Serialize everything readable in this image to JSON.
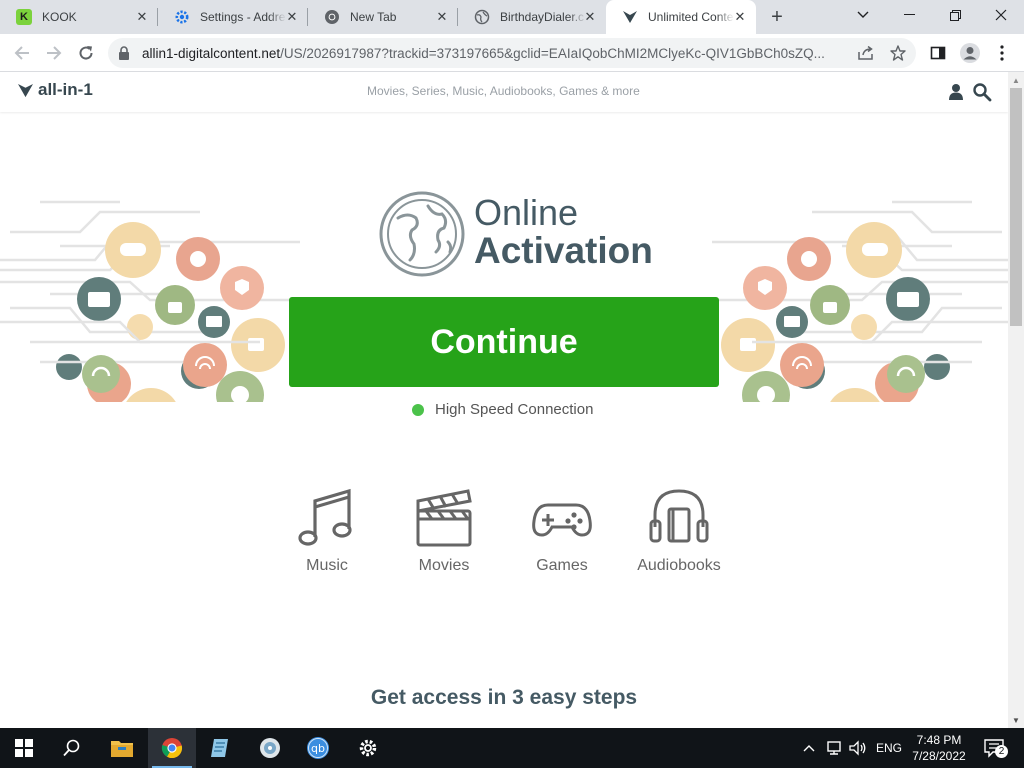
{
  "browser": {
    "tabs": [
      {
        "title": "KOOK",
        "icon": "kook-icon",
        "active": false
      },
      {
        "title": "Settings - Addre",
        "icon": "settings-gear-icon",
        "active": false
      },
      {
        "title": "New Tab",
        "icon": "chrome-icon",
        "active": false
      },
      {
        "title": "BirthdayDialer.c",
        "icon": "globe-icon",
        "active": false
      },
      {
        "title": "Unlimited Conte",
        "icon": "all-in-1-icon",
        "active": true
      }
    ],
    "url_host": "allin1-digitalcontent.net",
    "url_rest": "/US/2026917987?trackid=373197665&gclid=EAIaIQobChMI2MClyeKc-QIV1GbBCh0sZQ...",
    "accent_color": "#1a73e8"
  },
  "site": {
    "logo_text": "all-in-1",
    "tagline": "Movies, Series, Music, Audiobooks, Games & more",
    "hero_line1": "Online",
    "hero_line2": "Activation",
    "continue_label": "Continue",
    "continue_color": "#26a319",
    "connection_text": "High Speed Connection",
    "categories": [
      {
        "label": "Music",
        "icon": "music-note-icon"
      },
      {
        "label": "Movies",
        "icon": "clapperboard-icon"
      },
      {
        "label": "Games",
        "icon": "gamepad-icon"
      },
      {
        "label": "Audiobooks",
        "icon": "headphones-book-icon"
      }
    ],
    "steps_title": "Get access in 3 easy steps"
  },
  "taskbar": {
    "pinned": [
      "start-icon",
      "search-icon",
      "file-explorer-icon",
      "chrome-icon",
      "notepad-icon",
      "disc-app-icon",
      "qbittorrent-icon",
      "settings-icon"
    ],
    "language": "ENG",
    "time": "7:48 PM",
    "date": "7/28/2022",
    "notification_count": "2"
  }
}
